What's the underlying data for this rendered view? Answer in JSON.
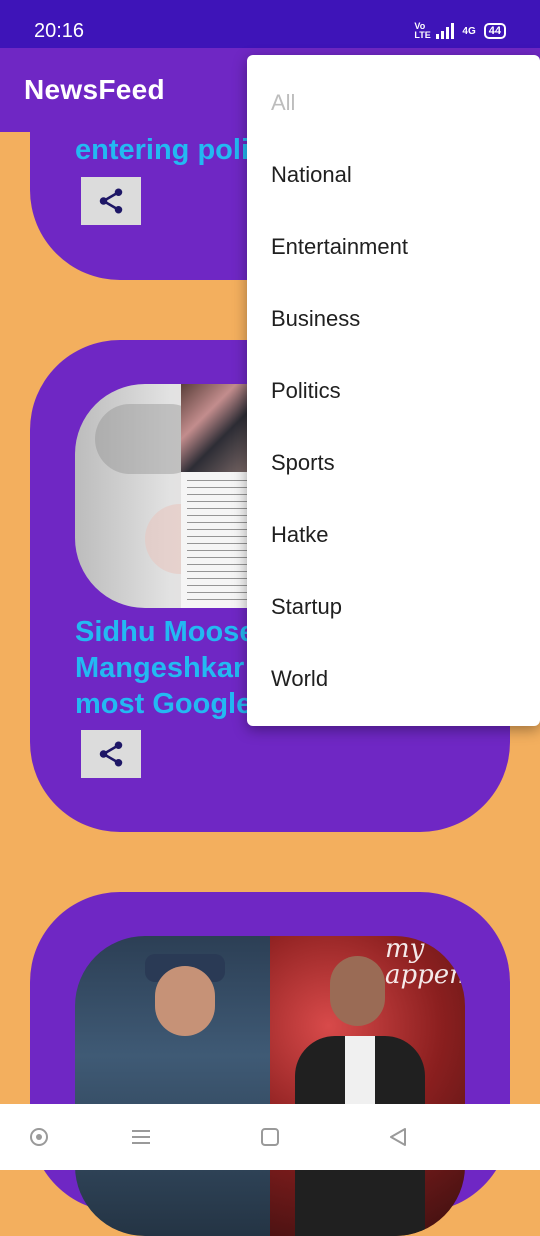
{
  "status_bar": {
    "time": "20:16",
    "network": "4G",
    "volte": "Vo LTE",
    "battery": "44"
  },
  "app_bar": {
    "title": "NewsFeed"
  },
  "cards": [
    {
      "headline": "entering poli"
    },
    {
      "headline": "Sidhu Moose\nMangeshkar\nmost Google"
    },
    {
      "headline": ""
    }
  ],
  "thumb3": {
    "neon_text": "my\nappen"
  },
  "menu": {
    "items": [
      {
        "label": "All",
        "enabled": false
      },
      {
        "label": "National",
        "enabled": true
      },
      {
        "label": "Entertainment",
        "enabled": true
      },
      {
        "label": "Business",
        "enabled": true
      },
      {
        "label": "Politics",
        "enabled": true
      },
      {
        "label": "Sports",
        "enabled": true
      },
      {
        "label": "Hatke",
        "enabled": true
      },
      {
        "label": "Startup",
        "enabled": true
      },
      {
        "label": "World",
        "enabled": true
      }
    ]
  },
  "icons": {
    "share": "share-icon",
    "nav_home": "circle-dot-icon",
    "nav_menu": "menu-lines-icon",
    "nav_recents": "square-icon",
    "nav_back": "triangle-back-icon"
  },
  "colors": {
    "status_bar": "#3E14B8",
    "app_bar": "#6F27C4",
    "card": "#6F27C4",
    "background": "#F3AF5E",
    "headline": "#23B9F2"
  }
}
